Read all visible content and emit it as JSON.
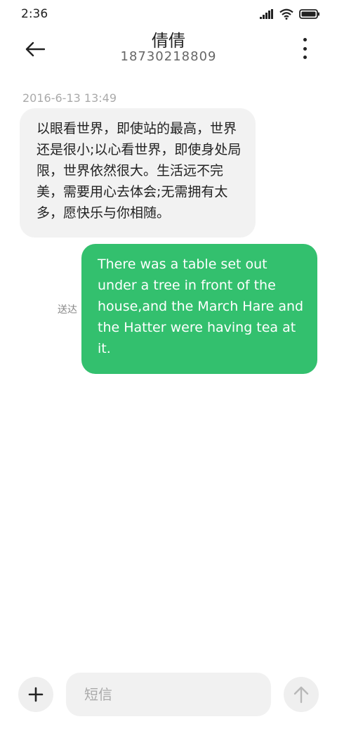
{
  "status_bar": {
    "time": "2:36"
  },
  "header": {
    "contact_name": "倩倩",
    "contact_number": "18730218809",
    "back_icon": "arrow-left-icon",
    "more_icon": "more-vertical-icon"
  },
  "messages": [
    {
      "direction": "incoming",
      "timestamp": "2016-6-13 13:49",
      "text": "以眼看世界，即使站的最高，世界还是很小;以心看世界，即使身处局限，世界依然很大。生活远不完美，需要用心去体会;无需拥有太多，愿快乐与你相随。"
    },
    {
      "direction": "outgoing",
      "status": "送达",
      "text": "There was a table set out under a tree in front of the house,and the March Hare and the Hatter were having tea at it."
    }
  ],
  "composer": {
    "placeholder": "短信",
    "add_icon": "plus-icon",
    "send_icon": "arrow-up-icon"
  },
  "colors": {
    "outgoing_bubble": "#33c06e",
    "incoming_bubble": "#f2f2f2"
  }
}
